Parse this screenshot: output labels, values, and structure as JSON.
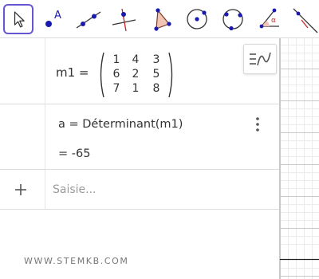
{
  "toolbar": {
    "tools": [
      {
        "name": "move-tool",
        "selected": true
      },
      {
        "name": "point-tool",
        "label": "A"
      },
      {
        "name": "line-tool"
      },
      {
        "name": "perpendicular-line-tool"
      },
      {
        "name": "polygon-tool"
      },
      {
        "name": "circle-center-point-tool"
      },
      {
        "name": "circle-three-points-tool"
      },
      {
        "name": "angle-tool",
        "label": "α"
      },
      {
        "name": "reflect-tool"
      }
    ]
  },
  "algebra": {
    "matrix_row": {
      "label": "m1 =",
      "values": [
        [
          1,
          4,
          3
        ],
        [
          6,
          2,
          5
        ],
        [
          7,
          1,
          8
        ]
      ]
    },
    "determinant_row": {
      "definition": "a = Déterminant(m1)",
      "result": "= -65"
    },
    "input_row": {
      "placeholder": "Saisie..."
    }
  },
  "watermark": "WWW.STEMKB.COM",
  "colors": {
    "accent": "#6557d2",
    "point_blue": "#1a1ab0",
    "polygon_fill": "#f2c4b4",
    "line_red": "#cc2222"
  }
}
